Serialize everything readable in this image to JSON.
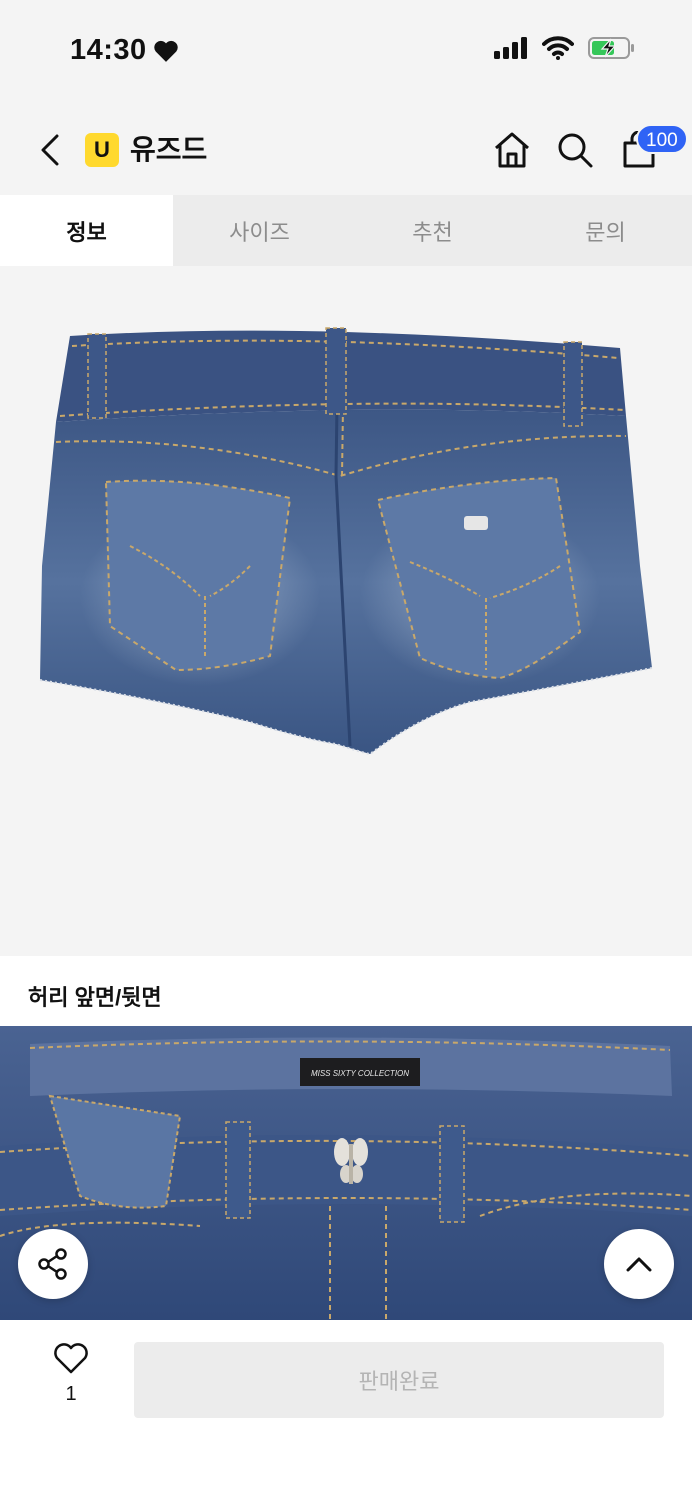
{
  "status_bar": {
    "time": "14:30"
  },
  "header": {
    "brand_logo": "U",
    "brand_name": "유즈드",
    "cart_count": "100"
  },
  "tabs": [
    {
      "label": "정보",
      "active": true
    },
    {
      "label": "사이즈",
      "active": false
    },
    {
      "label": "추천",
      "active": false
    },
    {
      "label": "문의",
      "active": false
    }
  ],
  "product": {
    "main_image": "denim-shorts-back",
    "caption": "허리 앞면/뒷면",
    "detail_image": "denim-waist-front",
    "waist_label": "MISS SIXTY COLLECTION"
  },
  "bottom": {
    "like_count": "1",
    "sold_label": "판매완료"
  },
  "colors": {
    "accent": "#2f63f5",
    "brand": "#ffd92e",
    "denim": "#3a5486"
  }
}
